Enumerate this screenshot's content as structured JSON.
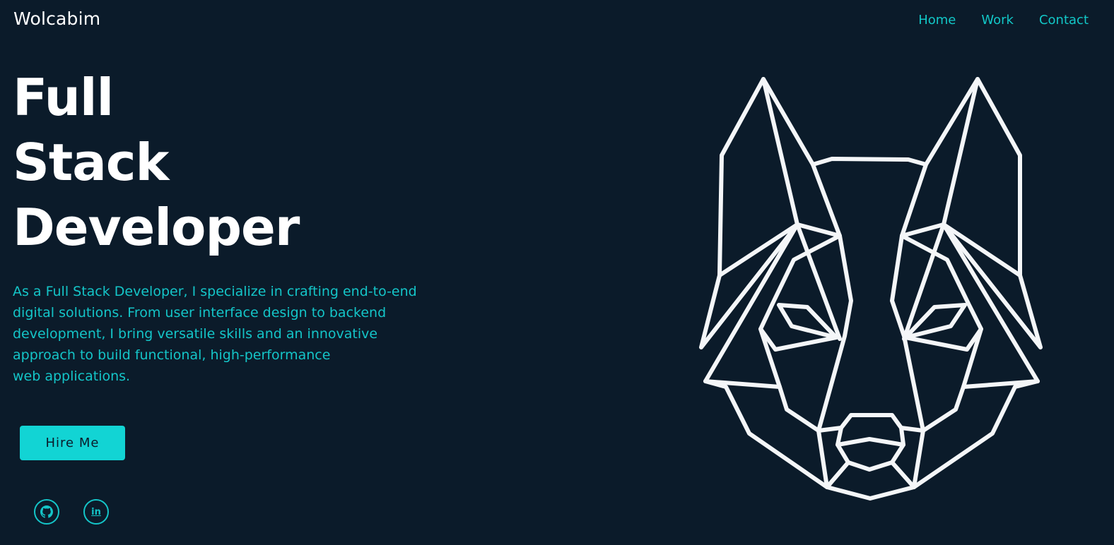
{
  "header": {
    "brand": "Wolcabim",
    "nav": [
      {
        "label": "Home"
      },
      {
        "label": "Work"
      },
      {
        "label": "Contact"
      }
    ]
  },
  "hero": {
    "headline": [
      "Full",
      "Stack",
      "Developer"
    ],
    "intro_lines": [
      "As a Full Stack Developer, I specialize in crafting end-to-end",
      "digital solutions. From user interface design to backend",
      "development, I bring versatile skills and an innovative",
      "approach to build functional, high-performance",
      "web applications."
    ],
    "cta_label": "Hire Me",
    "socials": [
      {
        "name": "github-icon"
      },
      {
        "name": "linkedin-icon",
        "glyph": "in"
      }
    ]
  },
  "colors": {
    "background": "#0b1b2a",
    "accent": "#12d4d4",
    "headline": "#ffffff",
    "illustration_stroke": "#f4f6f8"
  },
  "illustration": {
    "icon": "geometric-wolf-icon"
  }
}
